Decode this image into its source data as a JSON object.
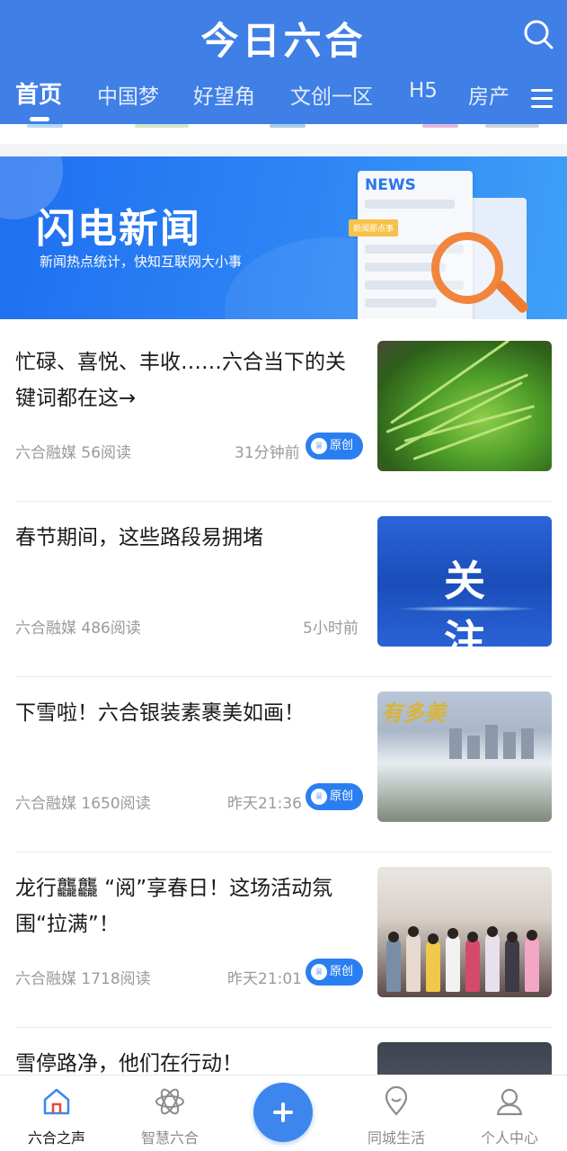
{
  "header": {
    "title": "今日六合",
    "tabs": [
      "首页",
      "中国梦",
      "好望角",
      "文创一区",
      "H5",
      "房产"
    ],
    "active_tab": "首页"
  },
  "banner": {
    "title": "闪电新闻",
    "subtitle": "新闻热点统计，快知互联网大小事",
    "paper_heading": "NEWS",
    "paper_tag": "新闻那点事"
  },
  "articles": [
    {
      "title": "忙碌、喜悦、丰收……六合当下的关键词都在这→",
      "source": "六合融媒 56阅读",
      "time": "31分钟前",
      "badge": "原创",
      "thumb": "vegetables"
    },
    {
      "title": "春节期间，这些路段易拥堵",
      "source": "六合融媒 486阅读",
      "time": "5小时前",
      "badge": "",
      "thumb_text": "关注"
    },
    {
      "title": "下雪啦！六合银装素裹美如画！",
      "source": "六合融媒 1650阅读",
      "time": "昨天21:36",
      "badge": "原创",
      "thumb_text": "有多美"
    },
    {
      "title": "龙行龘龘 “阅”享春日！这场活动氛围“拉满”！",
      "source": "六合融媒 1718阅读",
      "time": "昨天21:01",
      "badge": "原创",
      "thumb": "children"
    },
    {
      "title": "雪停路净，他们在行动！",
      "source": "",
      "time": "",
      "badge": "",
      "thumb": "road"
    }
  ],
  "bottom_nav": [
    {
      "label": "六合之声",
      "icon": "home-icon",
      "active": true
    },
    {
      "label": "智慧六合",
      "icon": "atom-icon",
      "active": false
    },
    {
      "label": "",
      "icon": "plus-icon",
      "active": false
    },
    {
      "label": "同城生活",
      "icon": "location-icon",
      "active": false
    },
    {
      "label": "个人中心",
      "icon": "user-icon",
      "active": false
    }
  ],
  "colors": {
    "primary": "#3f7fe6",
    "badge": "#2a7ff0",
    "meta_text": "#9a9a9a"
  }
}
